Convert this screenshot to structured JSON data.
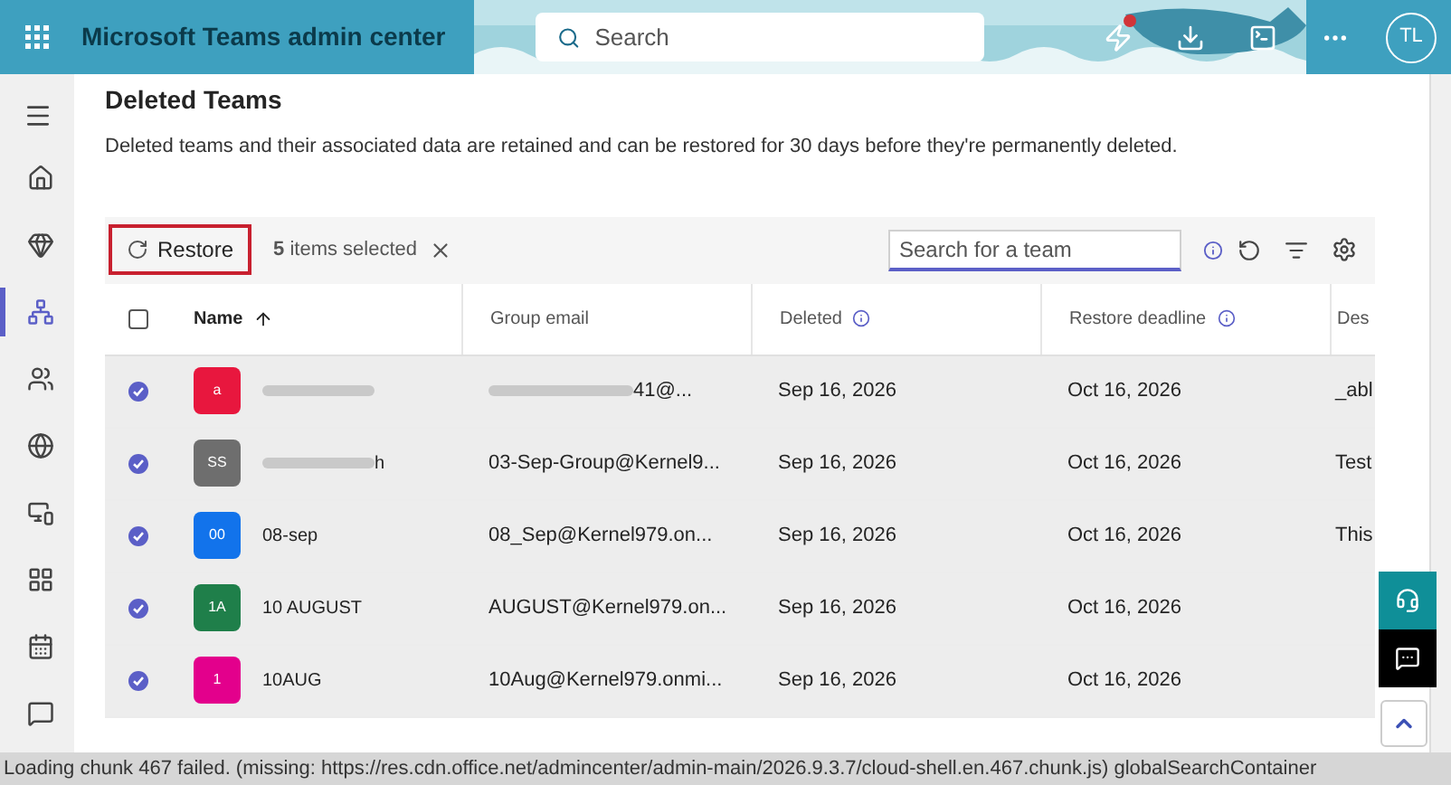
{
  "header": {
    "title": "Microsoft Teams admin center",
    "search": {
      "placeholder": "Search"
    },
    "avatar": "TL",
    "notification": true
  },
  "nav": [
    {
      "selected": false
    },
    {
      "selected": false
    },
    {
      "selected": true
    },
    {
      "selected": false
    },
    {
      "selected": false
    },
    {
      "selected": false
    },
    {
      "selected": false
    },
    {
      "selected": false
    },
    {
      "selected": false
    }
  ],
  "page": {
    "title": "Deleted Teams",
    "description": "Deleted teams and their associated data are retained and can be restored for 30 days before they're permanently deleted."
  },
  "toolbar": {
    "restore": "Restore",
    "selection": "**5** items selected",
    "search": {
      "placeholder": "Search for a team"
    }
  },
  "table": {
    "select_all": false,
    "columns": [
      {
        "label": "Name",
        "sort": true,
        "info": false
      },
      {
        "label": "Group email",
        "sort": false,
        "info": false
      },
      {
        "label": "Deleted",
        "sort": false,
        "info": true
      },
      {
        "label": "Restore deadline",
        "sort": false,
        "info": true
      },
      {
        "label": "Des",
        "sort": false
      }
    ],
    "rows": [
      {
        "selected": true,
        "initials": "a",
        "color": "#e8173e",
        "name_redacted": true,
        "email": "41@...",
        "email_redacted": true,
        "deleted": "Sep 16, 2026",
        "deadline": "Oct 16, 2026",
        "desc": "_abl"
      },
      {
        "selected": true,
        "initials": "SS",
        "color": "#6e6e6e",
        "name_redacted": true,
        "name": "h",
        "email": "03-Sep-Group@Kernel9...",
        "email_redacted": false,
        "deleted": "Sep 16, 2026",
        "deadline": "Oct 16, 2026",
        "desc": "Test"
      },
      {
        "selected": true,
        "initials": "00",
        "color": "#1273eb",
        "name_redacted": false,
        "name": "08-sep",
        "email": "08_Sep@Kernel979.on...",
        "email_redacted": false,
        "deleted": "Sep 16, 2026",
        "deadline": "Oct 16, 2026",
        "desc": "This"
      },
      {
        "selected": true,
        "initials": "1A",
        "color": "#1f7f4a",
        "name_redacted": false,
        "name": "10 AUGUST",
        "email": "AUGUST@Kernel979.on...",
        "email_redacted": false,
        "deleted": "Sep 16, 2026",
        "deadline": "Oct 16, 2026"
      },
      {
        "selected": true,
        "initials": "1",
        "color": "#e3008c",
        "name_redacted": false,
        "name": "10AUG",
        "email": "10Aug@Kernel979.onmi...",
        "email_redacted": false,
        "deleted": "Sep 16, 2026",
        "deadline": "Oct 16, 2026"
      }
    ]
  },
  "status_bar": "Loading chunk 467 failed. (missing: https://res.cdn.office.net/admincenter/admin-main/2026.9.3.7/cloud-shell.en.467.chunk.js) globalSearchContainer"
}
